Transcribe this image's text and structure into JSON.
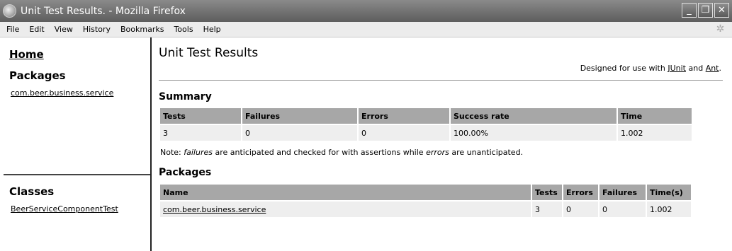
{
  "window": {
    "title": "Unit Test Results. - Mozilla Firefox",
    "min": "_",
    "max": "❐",
    "close": "✕"
  },
  "menu": [
    "File",
    "Edit",
    "View",
    "History",
    "Bookmarks",
    "Tools",
    "Help"
  ],
  "sidebar": {
    "home": "Home",
    "packages_heading": "Packages",
    "package_link": "com.beer.business.service",
    "classes_heading": "Classes",
    "class_link": "BeerServiceComponentTest"
  },
  "main": {
    "title": "Unit Test Results",
    "designed_prefix": "Designed for use with ",
    "junit": "JUnit",
    "and": " and ",
    "ant": "Ant",
    "designed_suffix": ".",
    "summary_heading": "Summary",
    "summary_headers": [
      "Tests",
      "Failures",
      "Errors",
      "Success rate",
      "Time"
    ],
    "summary_row": [
      "3",
      "0",
      "0",
      "100.00%",
      "1.002"
    ],
    "note_1": "Note: ",
    "note_failures": "failures",
    "note_2": " are anticipated and checked for with assertions while ",
    "note_errors": "errors",
    "note_3": " are unanticipated.",
    "packages_heading": "Packages",
    "packages_headers": [
      "Name",
      "Tests",
      "Errors",
      "Failures",
      "Time(s)"
    ],
    "packages_row": [
      "com.beer.business.service",
      "3",
      "0",
      "0",
      "1.002"
    ]
  }
}
